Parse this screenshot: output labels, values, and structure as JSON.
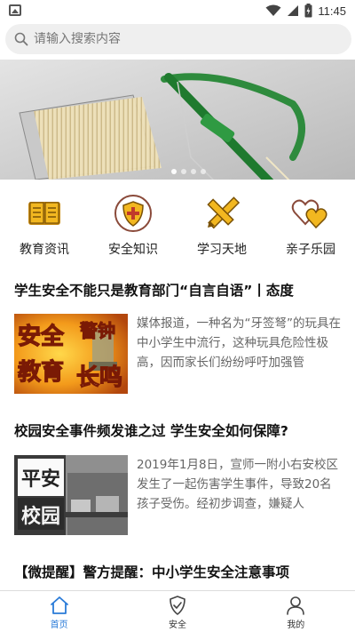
{
  "status_bar": {
    "time": "11:45"
  },
  "search": {
    "placeholder": "请输入搜索内容"
  },
  "banner": {
    "slide_count": 4,
    "active_index": 0
  },
  "categories": [
    {
      "label": "教育资讯",
      "icon": "book-icon"
    },
    {
      "label": "安全知识",
      "icon": "shield-plus-icon"
    },
    {
      "label": "学习天地",
      "icon": "pencil-ruler-icon"
    },
    {
      "label": "亲子乐园",
      "icon": "hearts-icon"
    }
  ],
  "articles": [
    {
      "title": "学生安全不能只是教育部门“自言自语”丨态度",
      "summary": "媒体报道，一种名为“牙签弩”的玩具在中小学生中流行，这种玩具危险性极高，因而家长们纷纷呼吁加强管",
      "thumb_text": [
        "安全",
        "警钟",
        "教育",
        "长鸣"
      ]
    },
    {
      "title": "校园安全事件频发谁之过 学生安全如何保障?",
      "summary": "2019年1月8日，宣师一附小右安校区发生了一起伤害学生事件，导致20名孩子受伤。经初步调查，嫌疑人",
      "thumb_text": [
        "平安",
        "校园"
      ]
    },
    {
      "title": "【微提醒】警方提醒：中小学生安全注意事项"
    }
  ],
  "tabs": [
    {
      "label": "首页",
      "icon": "home-icon",
      "active": true
    },
    {
      "label": "安全",
      "icon": "shield-check-icon",
      "active": false
    },
    {
      "label": "我的",
      "icon": "person-icon",
      "active": false
    }
  ],
  "colors": {
    "accent": "#2a7bd8",
    "icon_gold": "#e6a816"
  }
}
